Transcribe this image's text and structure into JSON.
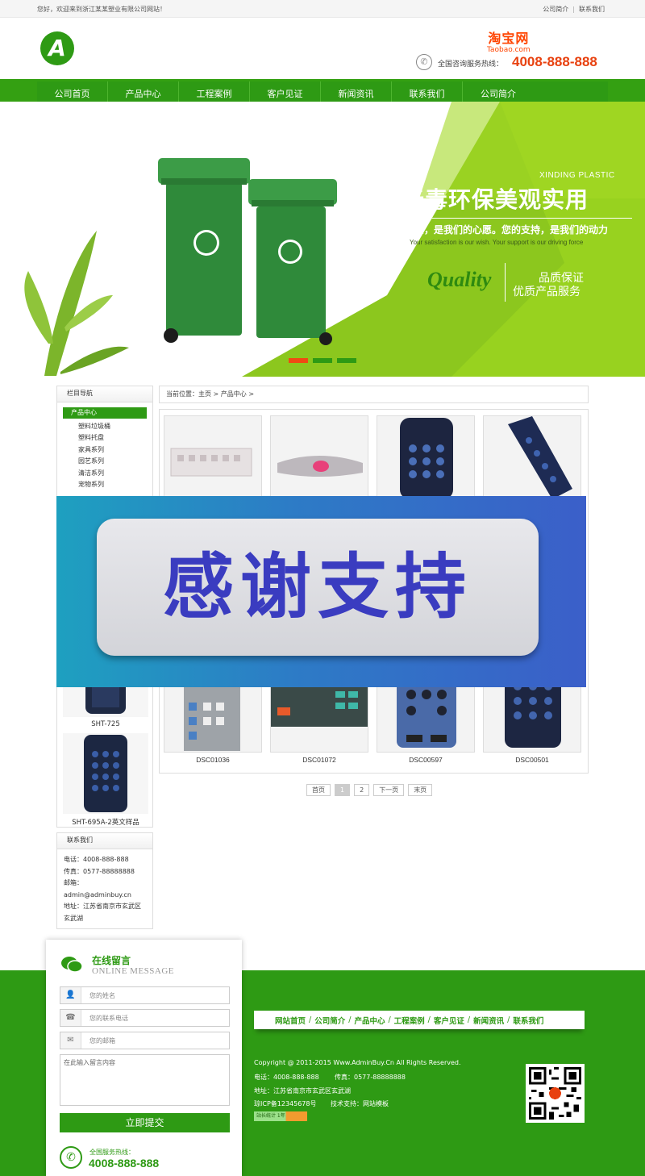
{
  "topbar": {
    "welcome": "您好，欢迎来到浙江某某塑业有限公司网站！",
    "links": [
      "公司简介",
      "联系我们"
    ]
  },
  "header": {
    "logo_letter": "A",
    "taobao_cn": "淘宝网",
    "taobao_en": "Taobao.com",
    "hotline_label": "全国咨询服务热线：",
    "hotline_number": "4008-888-888"
  },
  "nav": [
    "公司首页",
    "产品中心",
    "工程案例",
    "客户见证",
    "新闻资讯",
    "联系我们",
    "公司简介"
  ],
  "banner": {
    "brand": "XINDING PLASTIC",
    "title": "无毒环保美观实用",
    "subtitle": "您的满意，是我们的心愿。您的支持，是我们的动力",
    "subtitle_en": "Your satisfaction is our wish. Your support is our driving force",
    "quality": "Quality",
    "quality_line1": "品质保证",
    "quality_line2": "优质产品服务",
    "slides": 3,
    "active_slide": 1
  },
  "sidebar": {
    "nav_title": "栏目导航",
    "active_category": "产品中心",
    "categories": [
      "塑料垃圾桶",
      "塑料托盘",
      "家具系列",
      "园艺系列",
      "清洁系列",
      "宠物系列"
    ],
    "products": [
      {
        "caption": "SHT-725"
      },
      {
        "caption": "SHT-695A-2英文样品"
      }
    ],
    "contact_title": "联系我们",
    "contact": {
      "phone": "电话：4008-888-888",
      "fax": "传真：0577-88888888",
      "email_label": "邮箱：",
      "email": "admin@adminbuy.cn",
      "address_line1": "地址：江苏省南京市玄武区",
      "address_line2": "玄武湖"
    }
  },
  "breadcrumb": "当前位置：主页 > 产品中心 >",
  "products_row1": [
    {
      "caption": ""
    },
    {
      "caption": ""
    },
    {
      "caption": ""
    },
    {
      "caption": ""
    }
  ],
  "products_row3": [
    {
      "caption": "DSC01036"
    },
    {
      "caption": "DSC01072"
    },
    {
      "caption": "DSC00597"
    },
    {
      "caption": "DSC00501"
    }
  ],
  "pager": [
    "首页",
    "1",
    "2",
    "下一页",
    "末页"
  ],
  "overlay": {
    "text": "感谢支持"
  },
  "message": {
    "title": "在线留言",
    "subtitle": "ONLINE MESSAGE",
    "name_placeholder": "您的姓名",
    "phone_placeholder": "您的联系电话",
    "email_placeholder": "您的邮箱",
    "content_placeholder": "在此输入留言内容",
    "submit": "立即提交",
    "service_label": "全国服务热线：",
    "service_number": "4008-888-888"
  },
  "footer": {
    "nav": [
      "网站首页",
      "公司简介",
      "产品中心",
      "工程案例",
      "客户见证",
      "新闻资讯",
      "联系我们"
    ],
    "copyright": "Copyright @ 2011-2015 Www.AdminBuy.Cn All Rights Reserved.",
    "phone": "电话：4008-888-888",
    "fax": "传真：0577-88888888",
    "address": "地址：江苏省南京市玄武区玄武湖",
    "icp": "琼ICP备12345678号",
    "support": "技术支持：网站模板",
    "badge": "站长统计 1年"
  }
}
